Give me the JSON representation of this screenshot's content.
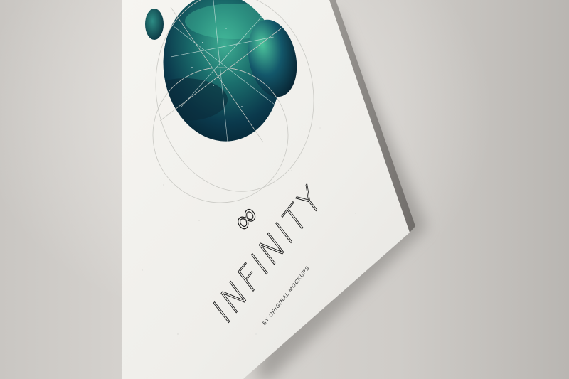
{
  "poster": {
    "logo_symbol": "∞",
    "title": "INFINITY",
    "subtitle": "BY ORIGINAL MOCKUPS"
  },
  "colors": {
    "wall": "#d4d1cd",
    "paper": "#f1f0ec",
    "space_dark": "#062a3a",
    "space_teal": "#1f8d7a",
    "line_ink": "#1a1a1a"
  },
  "icons": {
    "logo": "infinity-icon"
  }
}
